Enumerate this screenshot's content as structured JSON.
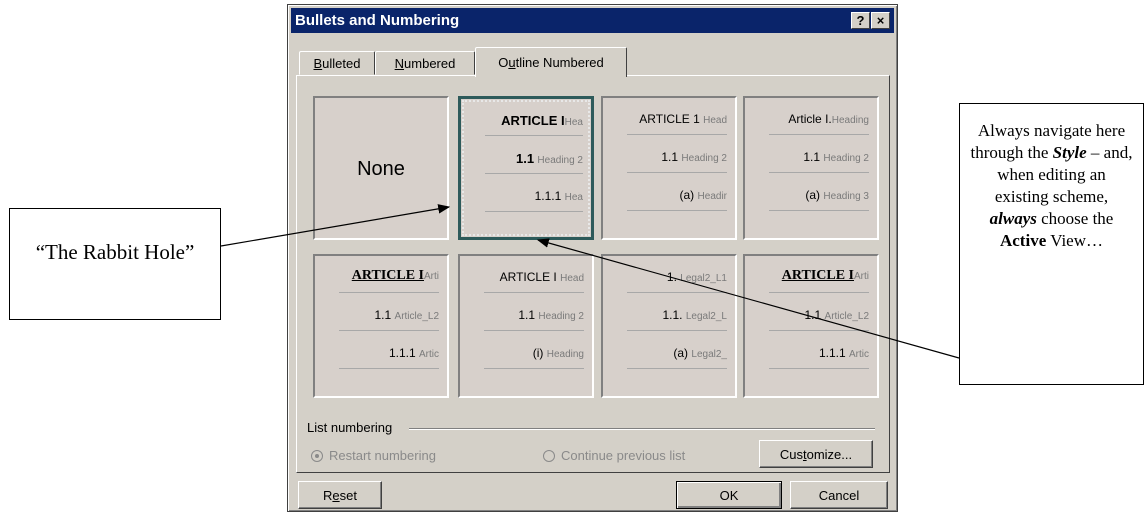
{
  "dialog": {
    "title": "Bullets and Numbering",
    "help_glyph": "?",
    "close_glyph": "×",
    "tabs": [
      {
        "pre": "",
        "ul": "B",
        "post": "ulleted"
      },
      {
        "pre": "",
        "ul": "N",
        "post": "umbered"
      },
      {
        "pre": "O",
        "ul": "u",
        "post": "tline Numbered"
      }
    ],
    "active_tab": "Outline Numbered",
    "gallery": {
      "none_label": "None",
      "cells": [
        {
          "l1n": "ARTICLE I",
          "l1r": "Hea",
          "l2n": "1.1",
          "l2r": "Heading 2",
          "l3n": "1.1.1",
          "l3r": "Hea"
        },
        {
          "l1n": "ARTICLE 1",
          "l1r": "Head",
          "l2n": "1.1",
          "l2r": "Heading 2",
          "l3n": "(a)",
          "l3r": "Headir"
        },
        {
          "l1n": "Article I.",
          "l1r": "Heading",
          "l2n": "1.1",
          "l2r": "Heading 2",
          "l3n": "(a)",
          "l3r": "Heading 3"
        },
        {
          "l1n": "ARTICLE I",
          "l1r": "Arti",
          "l2n": "1.1",
          "l2r": "Article_L2",
          "l3n": "1.1.1",
          "l3r": "Artic"
        },
        {
          "l1n": "ARTICLE I",
          "l1r": "Head",
          "l2n": "1.1",
          "l2r": "Heading 2",
          "l3n": "(i)",
          "l3r": "Heading"
        },
        {
          "l1n": "1.",
          "l1r": "Legal2_L1",
          "l2n": "1.1.",
          "l2r": "Legal2_L",
          "l3n": "(a)",
          "l3r": "Legal2_"
        },
        {
          "l1n": "ARTICLE I",
          "l1r": "Arti",
          "l2n": "1.1",
          "l2r": "Article_L2",
          "l3n": "1.1.1",
          "l3r": "Artic"
        }
      ]
    },
    "list_numbering": {
      "label": "List numbering",
      "restart": "Restart numbering",
      "continue": "Continue previous list"
    },
    "buttons": {
      "customize_pre": "Cus",
      "customize_ul": "t",
      "customize_post": "omize...",
      "reset_pre": "R",
      "reset_ul": "e",
      "reset_post": "set",
      "ok": "OK",
      "cancel": "Cancel"
    }
  },
  "annotations": {
    "left_callout": "“The Rabbit Hole”",
    "right_callout": {
      "p1": "Always navigate here through the",
      "style_word": "Style",
      "p2": " – and, when editing an existing scheme,",
      "always_word": "always",
      "p3": "choose the",
      "active_word": "Active",
      "p4": " View…"
    }
  }
}
